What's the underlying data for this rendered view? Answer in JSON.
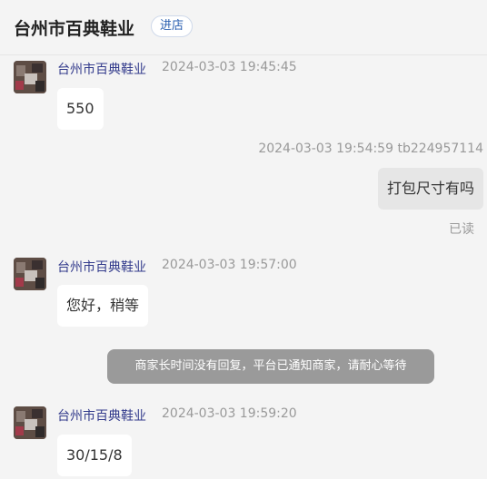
{
  "header": {
    "shop_name": "台州市百典鞋业",
    "enter_label": "进店"
  },
  "messages": [
    {
      "sender": "台州市百典鞋业",
      "time": "2024-03-03 19:45:45",
      "text": "550"
    },
    {
      "sender_time": "2024-03-03 19:54:59  tb224957114",
      "text": "打包尺寸有吗",
      "status": "已读"
    },
    {
      "sender": "台州市百典鞋业",
      "time": "2024-03-03 19:57:00",
      "text": "您好，稍等"
    },
    {
      "system": "商家长时间没有回复，平台已通知商家，请耐心等待"
    },
    {
      "sender": "台州市百典鞋业",
      "time": "2024-03-03 19:59:20",
      "text": "30/15/8"
    }
  ]
}
